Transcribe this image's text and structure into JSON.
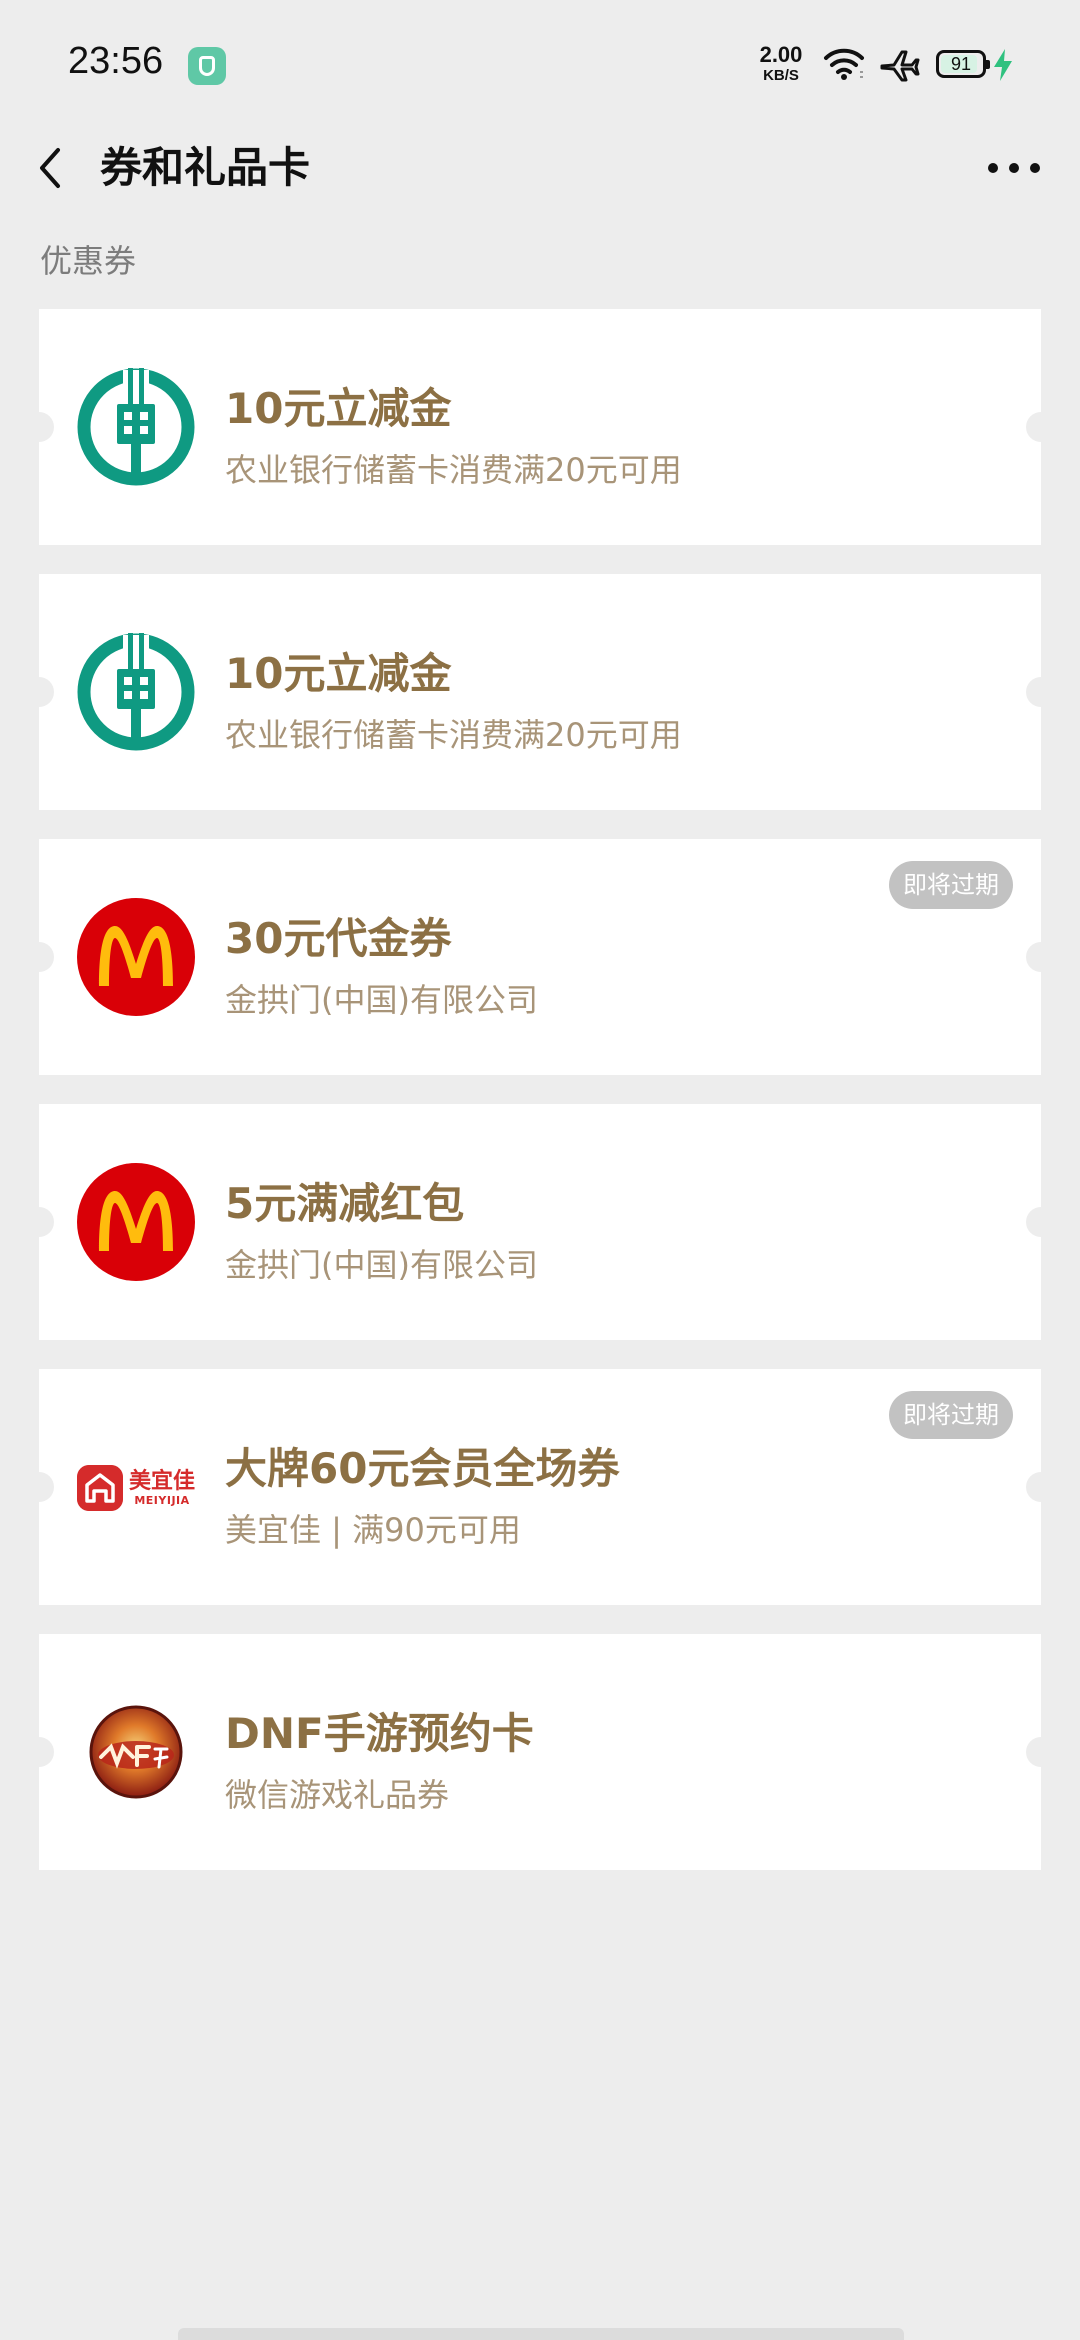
{
  "status_bar": {
    "time": "23:56",
    "net_speed_value": "2.00",
    "net_speed_unit": "KB/S",
    "battery_level": "91",
    "battery_fraction": 0.91,
    "icons": [
      "shield-app-icon",
      "wifi-icon",
      "airplane-icon",
      "battery-icon",
      "charging-bolt-icon"
    ]
  },
  "header": {
    "title": "券和礼品卡",
    "back_icon": "chevron-left-icon",
    "more_icon": "more-dots-icon"
  },
  "section": {
    "label": "优惠券"
  },
  "colors": {
    "background": "#ededed",
    "card": "#ffffff",
    "title_gold": "#8c7044",
    "subtitle_gold": "#a89478",
    "badge_gray": "#c2c2c2",
    "abc_green": "#0f9a82",
    "mcd_red": "#d90007",
    "mcd_yellow": "#ffbc0d",
    "meiyijia_red": "#d52b2b"
  },
  "coupons": [
    {
      "title": "10元立减金",
      "subtitle": "农业银行储蓄卡消费满20元可用",
      "logo": "abc-bank-logo",
      "badge": ""
    },
    {
      "title": "10元立减金",
      "subtitle": "农业银行储蓄卡消费满20元可用",
      "logo": "abc-bank-logo",
      "badge": ""
    },
    {
      "title": "30元代金券",
      "subtitle": "金拱门(中国)有限公司",
      "logo": "mcdonalds-logo",
      "badge": "即将过期"
    },
    {
      "title": "5元满减红包",
      "subtitle": "金拱门(中国)有限公司",
      "logo": "mcdonalds-logo",
      "badge": ""
    },
    {
      "title": "大牌60元会员全场券",
      "subtitle": "美宜佳 | 满90元可用",
      "logo": "meiyijia-logo",
      "logo_text_cn": "美宜佳",
      "logo_text_en": "MEIYIJIA",
      "badge": "即将过期"
    },
    {
      "title": "DNF手游预约卡",
      "subtitle": "微信游戏礼品券",
      "logo": "dnf-game-logo",
      "badge": ""
    }
  ]
}
